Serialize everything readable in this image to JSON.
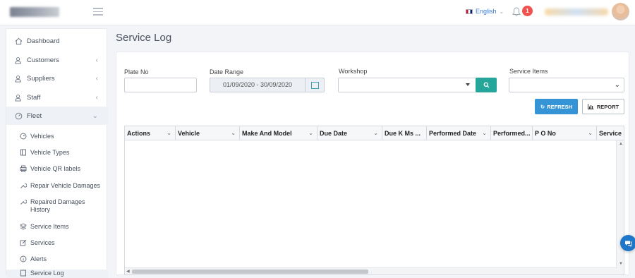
{
  "header": {
    "language": "English",
    "notifications_count": "1"
  },
  "sidebar": {
    "items": [
      {
        "label": "Dashboard",
        "icon": "home-icon"
      },
      {
        "label": "Customers",
        "icon": "users-icon"
      },
      {
        "label": "Suppliers",
        "icon": "users-icon"
      },
      {
        "label": "Staff",
        "icon": "users-icon"
      },
      {
        "label": "Fleet",
        "icon": "speedometer-icon"
      }
    ],
    "fleet_sub": [
      {
        "label": "Vehicles",
        "icon": "gauge-icon"
      },
      {
        "label": "Vehicle Types",
        "icon": "book-icon"
      },
      {
        "label": "Vehicle QR labels",
        "icon": "printer-icon"
      },
      {
        "label": "Repair Vehicle Damages",
        "icon": "wrench-icon"
      },
      {
        "label": "Repaired Damages History",
        "icon": "wrench-icon"
      },
      {
        "label": "Service Items",
        "icon": "stack-icon"
      },
      {
        "label": "Services",
        "icon": "edit-icon"
      },
      {
        "label": "Alerts",
        "icon": "info-icon"
      },
      {
        "label": "Service Log",
        "icon": "list-icon"
      }
    ]
  },
  "page": {
    "title": "Service Log"
  },
  "filters": {
    "plate_label": "Plate No",
    "plate_value": "",
    "date_label": "Date Range",
    "date_value": "01/09/2020 - 30/09/2020",
    "workshop_label": "Workshop",
    "workshop_value": "",
    "service_items_label": "Service Items",
    "service_items_value": ""
  },
  "actions": {
    "refresh": "REFRESH",
    "report": "REPORT"
  },
  "table": {
    "columns": [
      "Actions",
      "Vehicle",
      "Make And Model",
      "Due Date",
      "Due K Ms ...",
      "Performed Date",
      "Performed...",
      "P O No",
      "Service"
    ],
    "rows": []
  }
}
